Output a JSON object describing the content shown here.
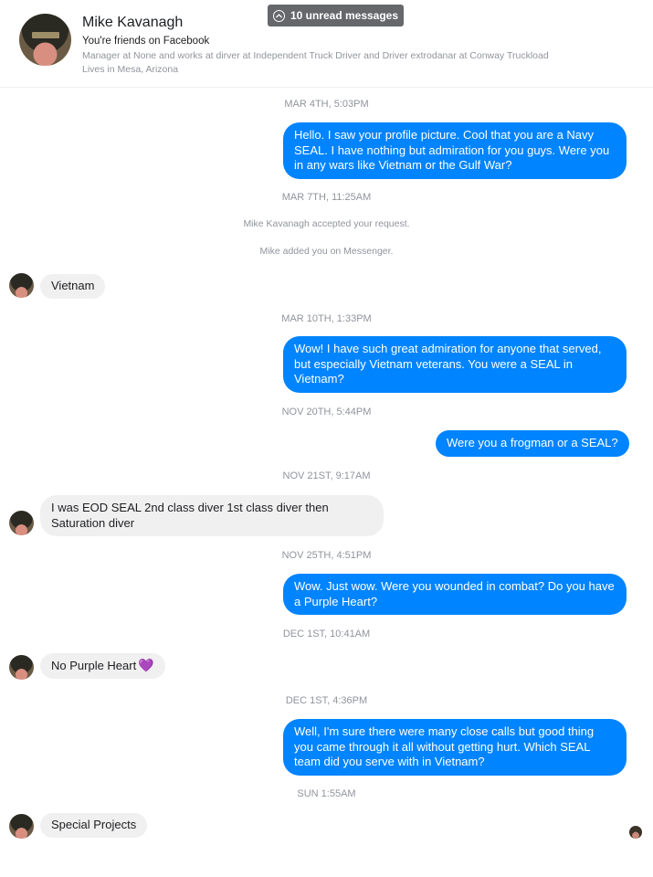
{
  "header": {
    "name": "Mike Kavanagh",
    "friends_text": "You're friends on Facebook",
    "work": "Manager at None and works at dirver at Independent Truck Driver and Driver extrodanar at Conway Truckload",
    "lives": "Lives in Mesa, Arizona",
    "avatar_icon": "profile-photo"
  },
  "unread": {
    "label": "10 unread messages",
    "icon": "chevron-up-circle-icon"
  },
  "colors": {
    "outgoing_bubble": "#0084ff",
    "incoming_bubble": "#f1f0f0",
    "timestamp": "#90949c"
  },
  "conversation": {
    "t1": "MAR 4TH, 5:03PM",
    "m1": "Hello.  I saw your profile picture.  Cool that you are a Navy SEAL. I have nothing but admiration for you guys.  Were you in any wars like Vietnam or the Gulf War?",
    "t2": "MAR 7TH, 11:25AM",
    "s1": "Mike Kavanagh accepted your request.",
    "s2": "Mike added you on Messenger.",
    "r1": "Vietnam",
    "t3": "MAR 10TH, 1:33PM",
    "m2": "Wow!  I have such great admiration for anyone that served, but especially Vietnam veterans.  You were a SEAL in Vietnam?",
    "t4": "NOV 20TH, 5:44PM",
    "m3": "Were you a frogman or a SEAL?",
    "t5": "NOV 21ST, 9:17AM",
    "r2": "I was EOD SEAL 2nd class diver 1st class diver then Saturation diver",
    "t6": "NOV 25TH, 4:51PM",
    "m4": "Wow.  Just wow.  Were you wounded in combat?  Do you have a Purple Heart?",
    "t7": "DEC 1ST, 10:41AM",
    "r3": "No Purple Heart",
    "r3_emoji": "💜",
    "t8": "DEC 1ST, 4:36PM",
    "m5": "Well, I'm sure there were many close calls but good thing you came through it all without getting hurt.  Which SEAL team did you serve with in Vietnam?",
    "t9": "SUN 1:55AM",
    "r4": "Special Projects"
  }
}
